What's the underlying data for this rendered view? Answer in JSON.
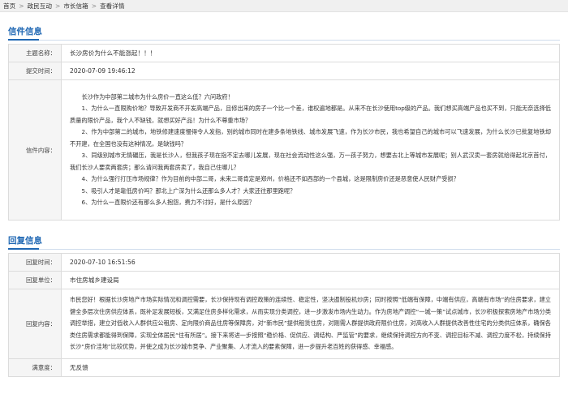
{
  "breadcrumb": {
    "items": [
      "首页",
      "政民互动",
      "市长信箱",
      "查看详情"
    ],
    "separator": ">"
  },
  "letter": {
    "section_title": "信件信息",
    "subject_label": "主题名称：",
    "subject": "长沙房价为什么不能涨起！！！",
    "time_label": "提交时间：",
    "time": "2020-07-09 19:46:12",
    "content_label": "信件内容：",
    "content": [
      "长沙作为中部第二城市为什么房价一直这么低？六问政府！",
      "1、为什么一直限购价地？导致开发商不开发高端产品，且修出来的房子一个比一个差，谁权遍地都是。从来不在长沙使用top级的产品。我们想买高端产品也买不到，只能无奈选择低质量的限价产品，我个人不缺钱，就想买好产品！为什么不尊重市场？",
      "2、作为中部第二的城市，地铁修建速度慢得令人发指，别的城市同时在建多条地铁线、城市发展飞速，作为长沙市民，我也希望自己的城市可以飞速发展，为什么长沙已批复地铁却不开建，在全国也没有这种情况，是缺钱吗？",
      "3、同级别城市无情碾压，我是长沙人，但我孩子现在指不定去哪儿发展，现在社会流动性这么强，万一孩子努力，想要去北上等城市发展呢；别人武汉卖一套房就给得起北京首付，我们长沙人要卖两套房；那么请问我两套房卖了，我自己住哪儿？",
      "4、为什么强行打压市场规律？作为目前的中部二哥，未来二哥肯定是郑州，价格还不如西部的一个县城，这是限制房价还是恶意使人民财产受损？",
      "5、吸引人才是靠低房价吗？那北上广深为什么还那么多人才？大家还往那里跑呢？",
      "6、为什么一直限价还有那么多人抱怨，费力不讨好，是什么原因？"
    ]
  },
  "reply": {
    "section_title": "回复信息",
    "time_label": "回复时间：",
    "time": "2020-07-10 16:51:56",
    "unit_label": "回复单位：",
    "unit": "市住房城乡建设局",
    "content_label": "回复内容：",
    "content": "市民您好！根据长沙房地产市场实际情况和调控需要，长沙保持现有调控政策的连续性、稳定性，坚决遏制投机炒房；同时按照“低端有保障，中端有供应，高端有市场”的住房要求，建立健全多层次住房供应体系，既补足发展短板，又满足住房多样化需求，从而实现分类调控，进一步激发市场内生动力。作为房地产调控“一城一策”试点城市，长沙积极探索房地产市场分类调控举措，建立对低收入人群供应公租房、定向限价商品住房等保障房，对“新市民”提供租赁住房，对刚需人群提供政府限价住房，对高收入人群提供改善性住宅的分类供应体系，确保各类住房需求都能得到保障，实现全体居民“住有所居”。接下来将进一步按照“稳价格、促供应、调结构、严监管”的要求，继续保持调控方向不变、调控目标不减、调控力度不松，持续保持长沙“房价洼地”比较优势，并使之成为长沙城市竞争、产业聚集、人才流入的要素保障，进一步提升老百姓的获得感、幸福感。",
    "satisfaction_label": "满意度：",
    "satisfaction": "无反馈"
  }
}
